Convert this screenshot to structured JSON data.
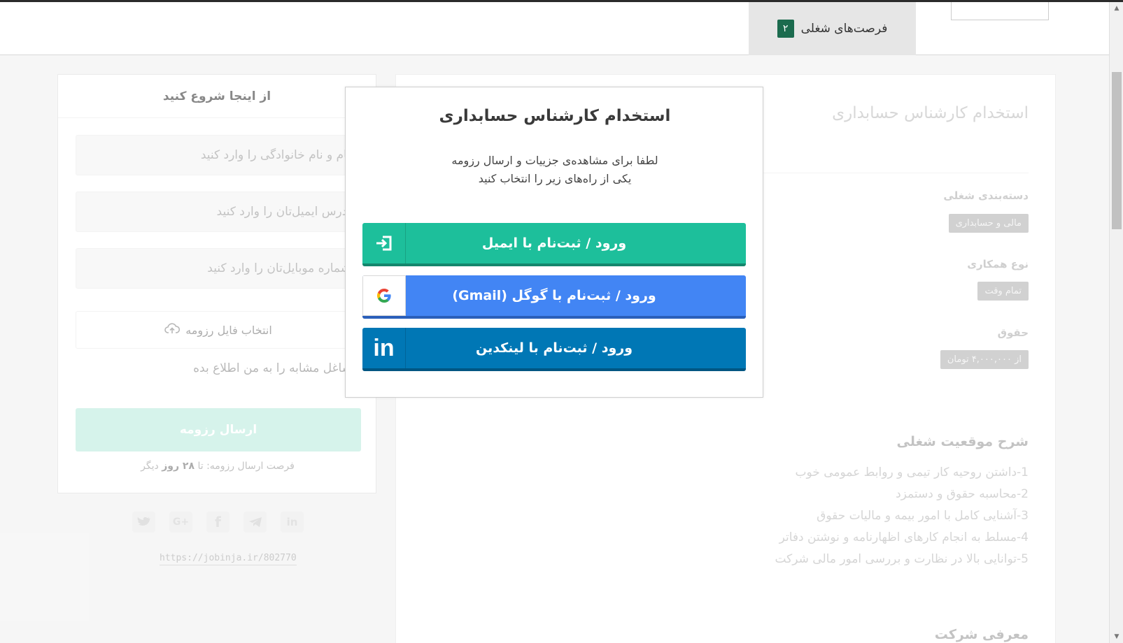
{
  "header": {
    "jobs_tab_label": "فرصت‌های شغلی",
    "jobs_tab_count": "۲"
  },
  "sidebar": {
    "heading": "از اینجا شروع کنید",
    "name_placeholder": "نام و نام خانوادگی را وارد کنید",
    "email_placeholder": "آدرس ایمیل‌تان را وارد کنید",
    "mobile_placeholder": "شماره موبایل‌تان را وارد کنید",
    "upload_label": "انتخاب فایل رزومه",
    "similar_jobs_label": "مشاغل مشابه را به من اطلاع بده",
    "send_button": "ارسال رزومه",
    "deadline_prefix": "فرصت ارسال رزومه: تا",
    "deadline_value": "۲۸ روز",
    "deadline_suffix": "دیگر",
    "social_icons": [
      "twitter-icon",
      "google-plus-icon",
      "facebook-icon",
      "telegram-icon",
      "linkedin-icon"
    ],
    "share_link": "https://jobinja.ir/802770"
  },
  "main": {
    "job_title": "استخدام کارشناس حسابداری",
    "category_label": "دسته‌بندی شغلی",
    "category_value": "مالی و حسابداری",
    "contract_label": "نوع همکاری",
    "contract_value": "تمام وقت",
    "salary_label": "حقوق",
    "salary_value": "از ۴,۰۰۰,۰۰۰ تومان",
    "description_title": "شرح موقعیت شغلی",
    "description_items": [
      "1-داشتن روحیه کار تیمی و روابط عمومی خوب",
      "2-محاسبه حقوق و دستمزد",
      "3-آشنایی کامل با امور بیمه و مالیات حقوق",
      "4-مسلط به انجام  کارهای اظهارنامه و نوشتن دفاتر",
      "5-توانایی بالا در نظارت و بررسی امور مالی شرکت"
    ],
    "company_title": "معرفی شرکت"
  },
  "modal": {
    "title": "استخدام کارشناس حسابداری",
    "text_line1": "لطفا برای مشاهده‌ی جزییات و ارسال رزومه",
    "text_line2": "یکی از راه‌های زیر را انتخاب کنید",
    "email_button": "ورود / ثبت‌نام با ایمیل",
    "google_button": "ورود / ثبت‌نام با گوگل (Gmail)",
    "linkedin_button": "ورود / ثبت‌نام با لینکدین"
  },
  "colors": {
    "email_green": "#1dbf9b",
    "google_blue": "#4285f4",
    "linkedin_blue": "#0077b5",
    "badge_green": "#1b6b4e"
  }
}
